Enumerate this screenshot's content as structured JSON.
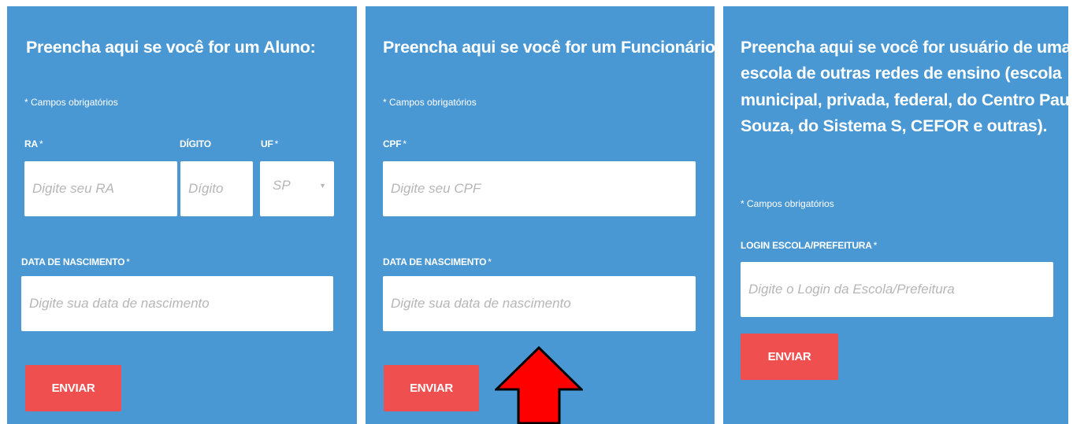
{
  "aluno": {
    "title": "Preencha aqui se você for um Aluno:",
    "required_note": "* Campos obrigatórios",
    "ra_label": "RA",
    "ra_placeholder": "Digite seu RA",
    "digito_label": "DÍGITO",
    "digito_placeholder": "Dígito",
    "uf_label": "UF",
    "uf_value": "SP",
    "birth_label": "DATA DE NASCIMENTO",
    "birth_placeholder": "Digite sua data de nascimento",
    "submit_label": "ENVIAR"
  },
  "funcionario": {
    "title": "Preencha aqui se você for um Funcionário:",
    "required_note": "* Campos obrigatórios",
    "cpf_label": "CPF",
    "cpf_placeholder": "Digite seu CPF",
    "birth_label": "DATA DE NASCIMENTO",
    "birth_placeholder": "Digite sua data de nascimento",
    "submit_label": "ENVIAR"
  },
  "outras_redes": {
    "title_lines": [
      "Preencha aqui se você for usuário de uma",
      "escola de outras redes de ensino (escola",
      "municipal, privada, federal, do Centro Paula",
      "Souza, do Sistema S, CEFOR e outras)."
    ],
    "required_note": "* Campos obrigatórios",
    "login_label": "LOGIN ESCOLA/PREFEITURA",
    "login_placeholder": "Digite o Login da Escola/Prefeitura",
    "submit_label": "ENVIAR"
  },
  "required_marker": "*",
  "colors": {
    "panel_bg": "#4a98d3",
    "button_bg": "#ef4f4f",
    "arrow": "#ff0000"
  },
  "annotation": {
    "icon": "up-arrow-icon"
  }
}
